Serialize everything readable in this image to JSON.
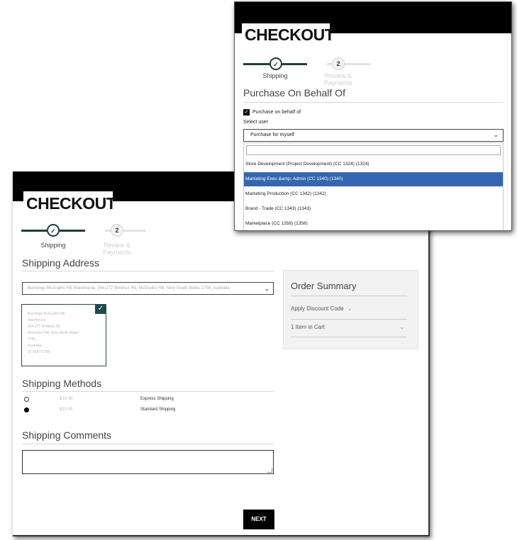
{
  "back_panel": {
    "title": "CHECKOUT",
    "steps": [
      {
        "number": "✓",
        "label": "Shipping"
      },
      {
        "number": "2",
        "label": "Review & Payments"
      }
    ],
    "shipping_address_title": "Shipping Address",
    "address_select_value": "Bunnings McGraths Hill Warehouse, 264-272 Windsor Rd, McGraths Hill, New South Wales 2756, Australia",
    "address_card_lines": [
      "Bunnings McGraths Hill",
      "Warehouse",
      "264-272 Windsor Rd",
      "McGraths Hill, New South Wales",
      "2756",
      "Australia",
      "02-9587-6788"
    ],
    "order_summary": {
      "title": "Order Summary",
      "discount_label": "Apply Discount Code",
      "items_label": "1 Item in Cart"
    },
    "shipping_methods_title": "Shipping Methods",
    "shipping_methods": [
      {
        "price": "$10.00",
        "name": "Express Shipping",
        "selected": false
      },
      {
        "price": "$10.00",
        "name": "Standard Shipping",
        "selected": true
      }
    ],
    "shipping_comments_title": "Shipping Comments",
    "next_label": "NEXT"
  },
  "front_panel": {
    "title": "CHECKOUT",
    "steps": [
      {
        "number": "✓",
        "label": "Shipping"
      },
      {
        "number": "2",
        "label": "Review & Payments"
      }
    ],
    "section_title": "Purchase On Behalf Of",
    "checkbox_label": "Purchase on behalf of",
    "checkbox_checked": true,
    "select_user_label": "Select user",
    "select_value": "Purchase for myself",
    "dropdown_options": [
      {
        "label": "Store Development (Project Development) (CC 1324) (1324)",
        "selected": false
      },
      {
        "label": "Marketing Exec &amp; Admin (CC 1340) (1340)",
        "selected": true
      },
      {
        "label": "Marketing Production (CC 1342) (1342)",
        "selected": false
      },
      {
        "label": "Brand - Trade (CC 1343) (1343)",
        "selected": false
      },
      {
        "label": "Marketplace (CC 1358) (1358)",
        "selected": false
      }
    ]
  },
  "colors": {
    "accent": "#1f3d3d",
    "highlight": "#3467b0",
    "topbar": "#000000"
  }
}
